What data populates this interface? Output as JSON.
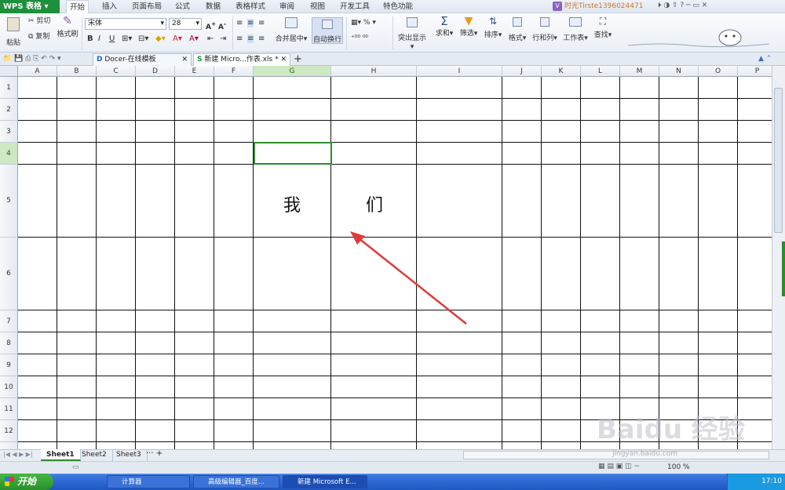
{
  "app": {
    "logo": "WPS 表格"
  },
  "menu": {
    "items": [
      "开始",
      "插入",
      "页面布局",
      "公式",
      "数据",
      "表格样式",
      "审阅",
      "视图",
      "开发工具",
      "特色功能"
    ],
    "active_index": 0
  },
  "user": {
    "name": "时光Tirste1396024471"
  },
  "ribbon": {
    "paste": "粘贴",
    "cut": "剪切",
    "copy": "复制",
    "format_painter": "格式刷",
    "font_name": "宋体",
    "font_size": "28",
    "merge_center": "合并居中",
    "wrap_text": "自动换行",
    "percent": "%",
    "conditional": "突出显示",
    "sum": "求和",
    "filter": "筛选",
    "sort": "排序",
    "format": "格式",
    "rows_cols": "行和列",
    "worksheet": "工作表",
    "find": "查找"
  },
  "tabs": [
    {
      "label": "Docer-在线模板"
    },
    {
      "label": "新建 Micro...作表.xls *"
    }
  ],
  "grid": {
    "columns": [
      "A",
      "B",
      "C",
      "D",
      "E",
      "F",
      "G",
      "H",
      "I",
      "J",
      "K",
      "L",
      "M",
      "N",
      "O",
      "P"
    ],
    "rows": [
      "1",
      "2",
      "3",
      "4",
      "5",
      "6",
      "7",
      "8",
      "9",
      "10",
      "11",
      "12",
      "13"
    ],
    "selected_column": "G",
    "selected_row": "4",
    "cell_g5": "我",
    "cell_h5": "们"
  },
  "sheets": [
    "Sheet1",
    "Sheet2",
    "Sheet3"
  ],
  "status": {
    "zoom": "100 %"
  },
  "taskbar": {
    "start": "开始",
    "tasks": [
      "计算器",
      "高级编辑器_百度...",
      "新建 Microsoft E..."
    ],
    "time": "17:10"
  },
  "watermark": {
    "text": "Baidu 经验",
    "sub": "jingyan.baidu.com"
  },
  "colors": {
    "accent": "#2e8b2e",
    "arrow": "#e03a3a",
    "taskbar": "#245edb"
  }
}
